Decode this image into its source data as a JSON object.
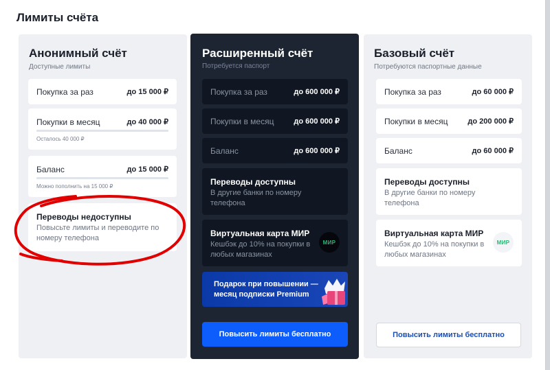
{
  "page": {
    "title": "Лимиты счёта"
  },
  "colors": {
    "accent": "#0c5dfc",
    "dark_card": "#1d2533",
    "annotation": "#e00000"
  },
  "anonymous": {
    "title": "Анонимный счёт",
    "subtitle": "Доступные лимиты",
    "purchase_once": {
      "label": "Покупка за раз",
      "value": "до 15 000 ₽"
    },
    "purchase_month": {
      "label": "Покупки в месяц",
      "value": "до 40 000 ₽",
      "note": "Осталось 40 000 ₽",
      "progress_used": 0
    },
    "balance": {
      "label": "Баланс",
      "value": "до 15 000 ₽",
      "note": "Можно пополнить на 15 000 ₽",
      "progress_used": 0
    },
    "transfers": {
      "title": "Переводы недоступны",
      "desc": "Повысьте лимиты и переводите по номеру телефона"
    }
  },
  "extended": {
    "title": "Расширенный счёт",
    "subtitle": "Потребуется паспорт",
    "purchase_once": {
      "label": "Покупка за раз",
      "value": "до 600 000 ₽"
    },
    "purchase_month": {
      "label": "Покупки в месяц",
      "value": "до 600 000 ₽"
    },
    "balance": {
      "label": "Баланс",
      "value": "до 600 000 ₽"
    },
    "transfers": {
      "title": "Переводы доступны",
      "desc": "В другие банки по номеру телефона"
    },
    "virtual_card": {
      "title": "Виртуальная карта МИР",
      "desc": "Кешбэк до 10% на покупки в любых магазинах",
      "logo": "МИР",
      "icon": "mir-logo-icon"
    },
    "promo": {
      "text": "Подарок при повышении — месяц подписки Premium",
      "icon": "gift-crown-icon"
    },
    "button": "Повысить лимиты бесплатно"
  },
  "basic": {
    "title": "Базовый счёт",
    "subtitle": "Потребуются паспортные данные",
    "purchase_once": {
      "label": "Покупка за раз",
      "value": "до 60 000 ₽"
    },
    "purchase_month": {
      "label": "Покупки в месяц",
      "value": "до 200 000 ₽"
    },
    "balance": {
      "label": "Баланс",
      "value": "до 60 000 ₽"
    },
    "transfers": {
      "title": "Переводы доступны",
      "desc": "В другие банки по номеру телефона"
    },
    "virtual_card": {
      "title": "Виртуальная карта МИР",
      "desc": "Кешбэк до 10% на покупки в любых магазинах",
      "logo": "МИР",
      "icon": "mir-logo-icon"
    },
    "button": "Повысить лимиты бесплатно"
  }
}
